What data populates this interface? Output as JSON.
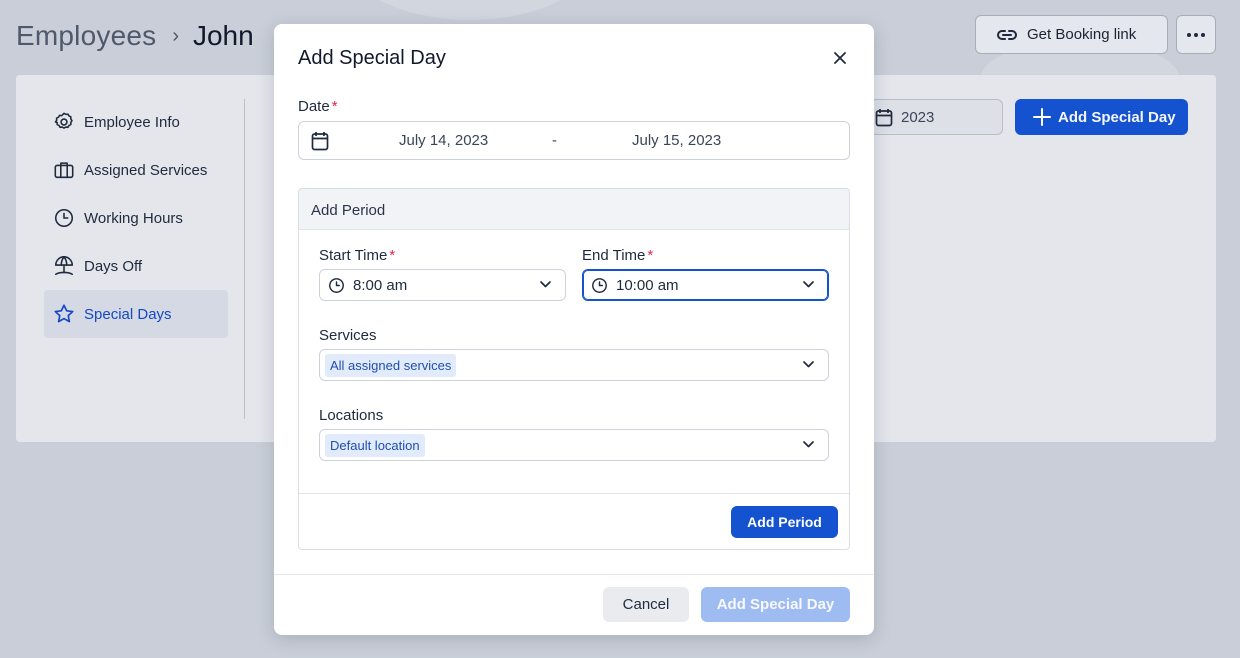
{
  "header": {
    "breadcrumb_root": "Employees",
    "breadcrumb_separator": "›",
    "breadcrumb_current": "John",
    "booking_link_label": "Get Booking link",
    "more_icon": "more-horizontal-icon"
  },
  "sidebar": {
    "items": [
      {
        "label": "Employee Info",
        "icon": "gear-icon",
        "active": false
      },
      {
        "label": "Assigned Services",
        "icon": "briefcase-icon",
        "active": false
      },
      {
        "label": "Working Hours",
        "icon": "clock-icon",
        "active": false
      },
      {
        "label": "Days Off",
        "icon": "beach-umbrella-icon",
        "active": false
      },
      {
        "label": "Special Days",
        "icon": "star-icon",
        "active": true
      }
    ]
  },
  "toolbar": {
    "year": "2023",
    "add_special_day_label": "Add Special Day"
  },
  "modal": {
    "title": "Add Special Day",
    "date_label": "Date",
    "date_from": "July 14, 2023",
    "date_separator": "-",
    "date_to": "July 15, 2023",
    "period": {
      "title": "Add Period",
      "start_time_label": "Start Time",
      "start_time_value": "8:00 am",
      "end_time_label": "End Time",
      "end_time_value": "10:00 am",
      "services_label": "Services",
      "services_value": "All assigned services",
      "locations_label": "Locations",
      "locations_value": "Default location",
      "add_period_label": "Add Period"
    },
    "required_marker": "*",
    "cancel_label": "Cancel",
    "submit_label": "Add Special Day"
  },
  "colors": {
    "primary": "#1552cf",
    "primary_disabled": "#9ebcf2",
    "required": "#e0264a",
    "overlay_bg": "#c9ced8"
  }
}
